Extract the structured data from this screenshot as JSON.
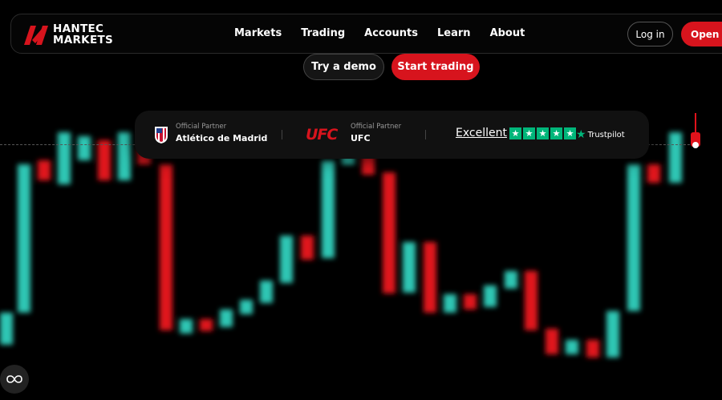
{
  "brand": {
    "line1": "HANTEC",
    "line2": "MARKETS",
    "accent": "#d7141d"
  },
  "nav": {
    "items": [
      {
        "label": "Markets"
      },
      {
        "label": "Trading"
      },
      {
        "label": "Accounts"
      },
      {
        "label": "Learn"
      },
      {
        "label": "About"
      }
    ],
    "login_label": "Log in",
    "open_label": "Open a"
  },
  "cta": {
    "demo_label": "Try a demo",
    "start_label": "Start trading"
  },
  "partners": {
    "atletico": {
      "small": "Official Partner",
      "name": "Atlético de Madrid"
    },
    "ufc": {
      "logo": "UFC",
      "small": "Official Partner",
      "name": "UFC"
    },
    "trustpilot": {
      "rating_label": "Excellent",
      "stars": 5,
      "brand": "Trustpilot",
      "color": "#00b67a"
    }
  },
  "chart_colors": {
    "up": "#2fc6b4",
    "down": "#e0121b"
  },
  "icons": {
    "toggle": "infinity-icon"
  }
}
